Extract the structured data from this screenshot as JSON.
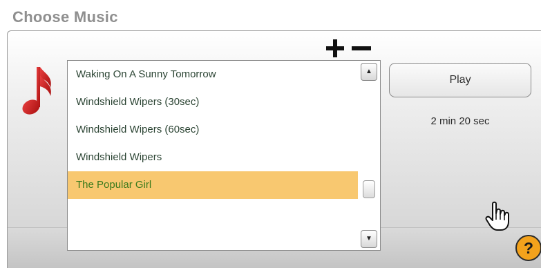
{
  "title": "Choose Music",
  "music_icon": "music-note-icon",
  "add_icon": "plus-icon",
  "remove_icon": "minus-icon",
  "songs": [
    "Waking On A Sunny Tomorrow",
    "Windshield Wipers (30sec)",
    "Windshield Wipers (60sec)",
    "Windshield Wipers",
    "The Popular Girl"
  ],
  "selected_song": "The Popular Girl",
  "scroll_up_glyph": "▲",
  "scroll_down_glyph": "▼",
  "play_label": "Play",
  "duration": "2 min 20 sec",
  "help_label": "?",
  "colors": {
    "selection": "#f8c870",
    "selected_text": "#3a7a1c",
    "music_note": "#cc1e1e",
    "help": "#f3a21c"
  }
}
